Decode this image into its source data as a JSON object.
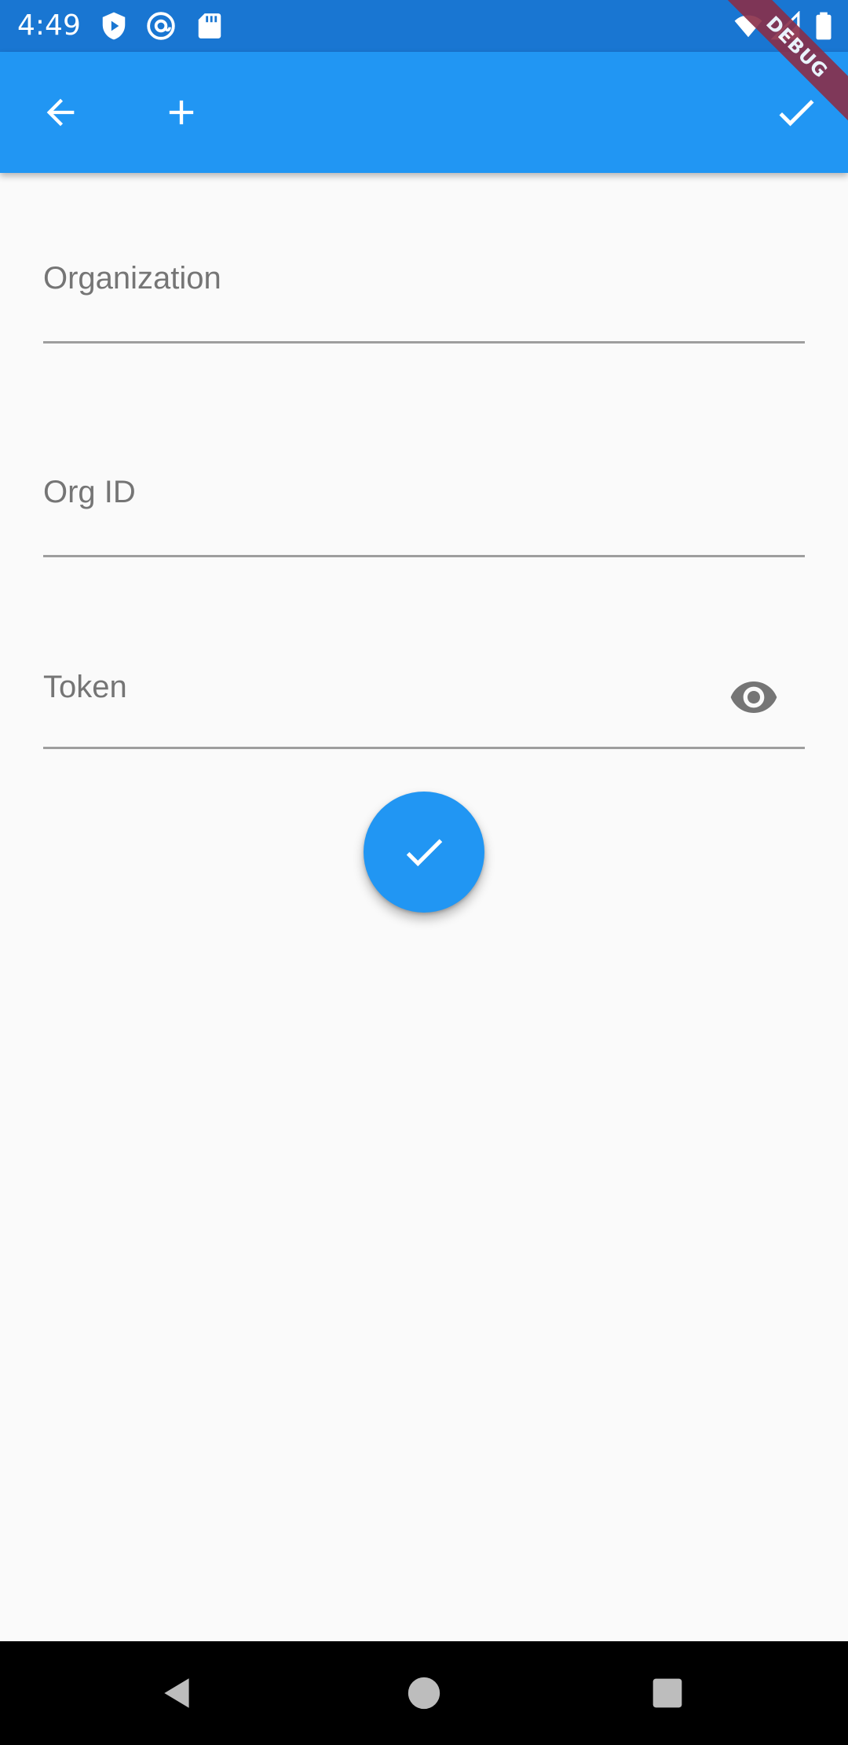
{
  "status_bar": {
    "time": "4:49",
    "left_icons": [
      "shield-play-icon",
      "at-sign-icon",
      "sd-card-icon"
    ],
    "right_icons": [
      "wifi-icon",
      "cell-signal-icon",
      "battery-icon"
    ],
    "background": "#1976d2"
  },
  "app_bar": {
    "background": "#2196f3",
    "back_icon": "arrow-back-icon",
    "add_icon": "plus-icon",
    "confirm_icon": "check-icon"
  },
  "debug_banner": {
    "label": "DEBUG"
  },
  "form": {
    "organization": {
      "label": "Organization",
      "value": ""
    },
    "org_id": {
      "label": "Org ID",
      "value": ""
    },
    "token": {
      "label": "Token",
      "value": "",
      "visibility_icon": "eye-icon"
    }
  },
  "fab": {
    "icon": "check-icon",
    "color": "#2196f3"
  },
  "nav_bar": {
    "back_icon": "triangle-back-icon",
    "home_icon": "circle-home-icon",
    "recents_icon": "square-recents-icon"
  }
}
